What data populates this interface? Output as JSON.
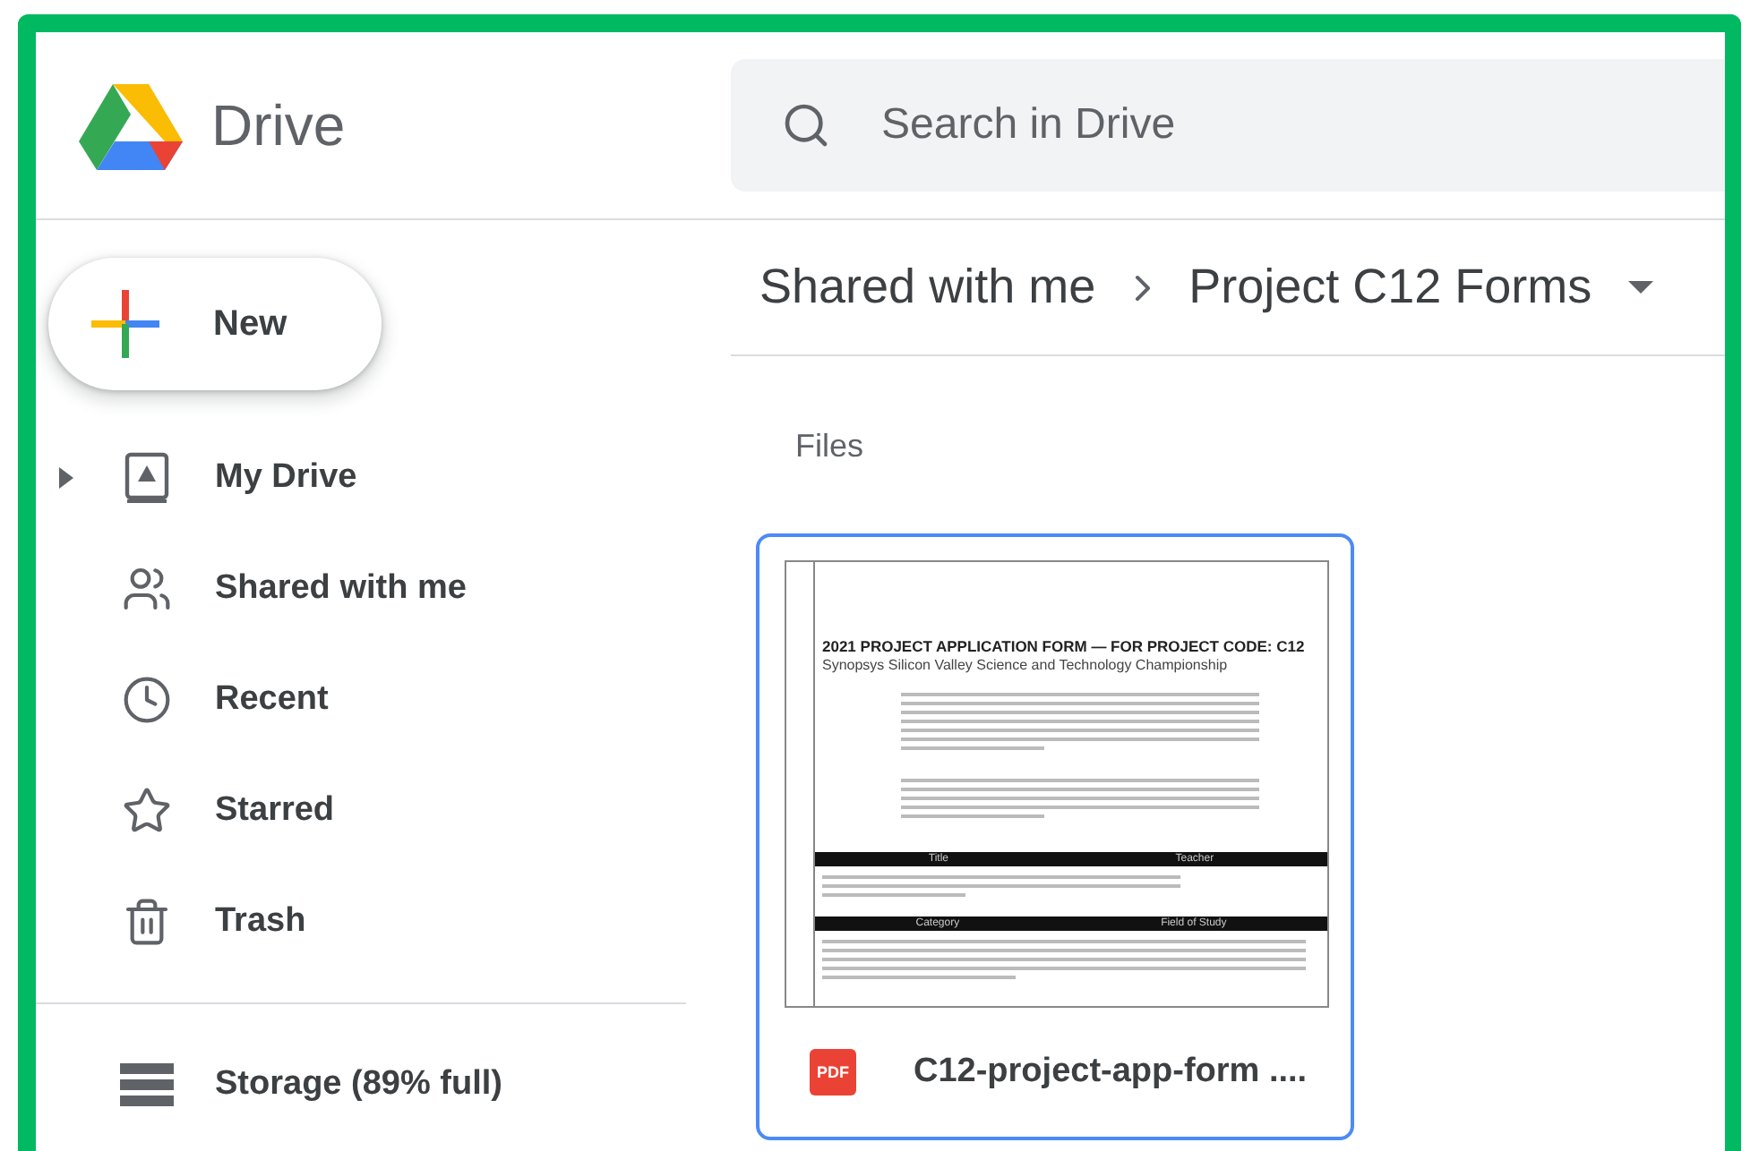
{
  "app": {
    "name": "Drive"
  },
  "search": {
    "placeholder": "Search in Drive"
  },
  "new_button": {
    "label": "New"
  },
  "nav": [
    {
      "label": "My Drive",
      "kind": "drive",
      "expandable": true
    },
    {
      "label": "Shared with me",
      "kind": "shared",
      "expandable": false
    },
    {
      "label": "Recent",
      "kind": "recent",
      "expandable": false
    },
    {
      "label": "Starred",
      "kind": "starred",
      "expandable": false
    },
    {
      "label": "Trash",
      "kind": "trash",
      "expandable": false
    }
  ],
  "storage": {
    "label": "Storage (89% full)"
  },
  "breadcrumb": [
    "Shared with me",
    "Project C12 Forms"
  ],
  "section": "Files",
  "files": [
    {
      "name": "C12-project-app-form ....",
      "type": "PDF",
      "selected": true,
      "thumbnail": {
        "title": "2021 PROJECT APPLICATION FORM — FOR PROJECT CODE: C12",
        "subtitle": "Synopsys Silicon Valley Science and Technology Championship",
        "headers": [
          "Title",
          "Teacher"
        ],
        "headers_2": [
          "Category",
          "Field of Study"
        ]
      }
    }
  ]
}
